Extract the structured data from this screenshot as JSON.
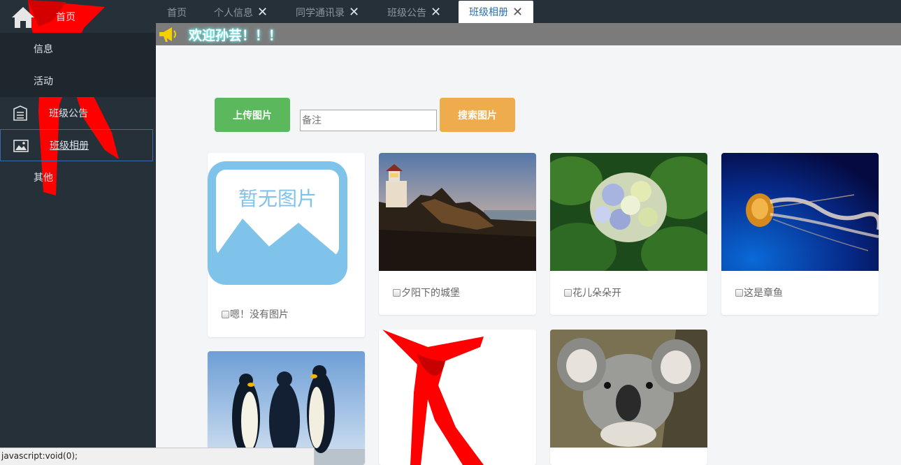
{
  "sidebar": {
    "home": "首页",
    "info": "信息",
    "activity": "活动",
    "notice": "班级公告",
    "album": "班级相册",
    "other": "其他"
  },
  "tabs": [
    {
      "label": "首页"
    },
    {
      "label": "个人信息",
      "close": "✕"
    },
    {
      "label": "同学通讯录",
      "close": "✕"
    },
    {
      "label": "班级公告",
      "close": "✕"
    },
    {
      "label": "班级相册",
      "close": "✕",
      "active": true
    }
  ],
  "welcome": "欢迎孙芸！！！",
  "toolbar": {
    "upload_label": "上传图片",
    "remark_placeholder": "备注",
    "search_label": "搜索图片"
  },
  "placeholder_image_text": "暂无图片",
  "photos": [
    {
      "caption": "嗯！没有图片",
      "image": "no-image-placeholder"
    },
    {
      "caption": "夕阳下的城堡",
      "image": "lighthouse-sunset"
    },
    {
      "caption": "花儿朵朵开",
      "image": "hydrangea-flower"
    },
    {
      "caption": "这是章鱼",
      "image": "jellyfish"
    },
    {
      "caption": "",
      "image": "penguins"
    },
    {
      "caption": "",
      "image": "red-scarf"
    },
    {
      "caption": "",
      "image": "koala"
    }
  ],
  "statusbar": "javascript:void(0);",
  "colors": {
    "sidebar_bg": "#263038",
    "upload_button": "#5cb85c",
    "search_button": "#eeac4c",
    "active_tab_text": "#2a6fb5",
    "welcome_bar": "#7b7b7b"
  }
}
